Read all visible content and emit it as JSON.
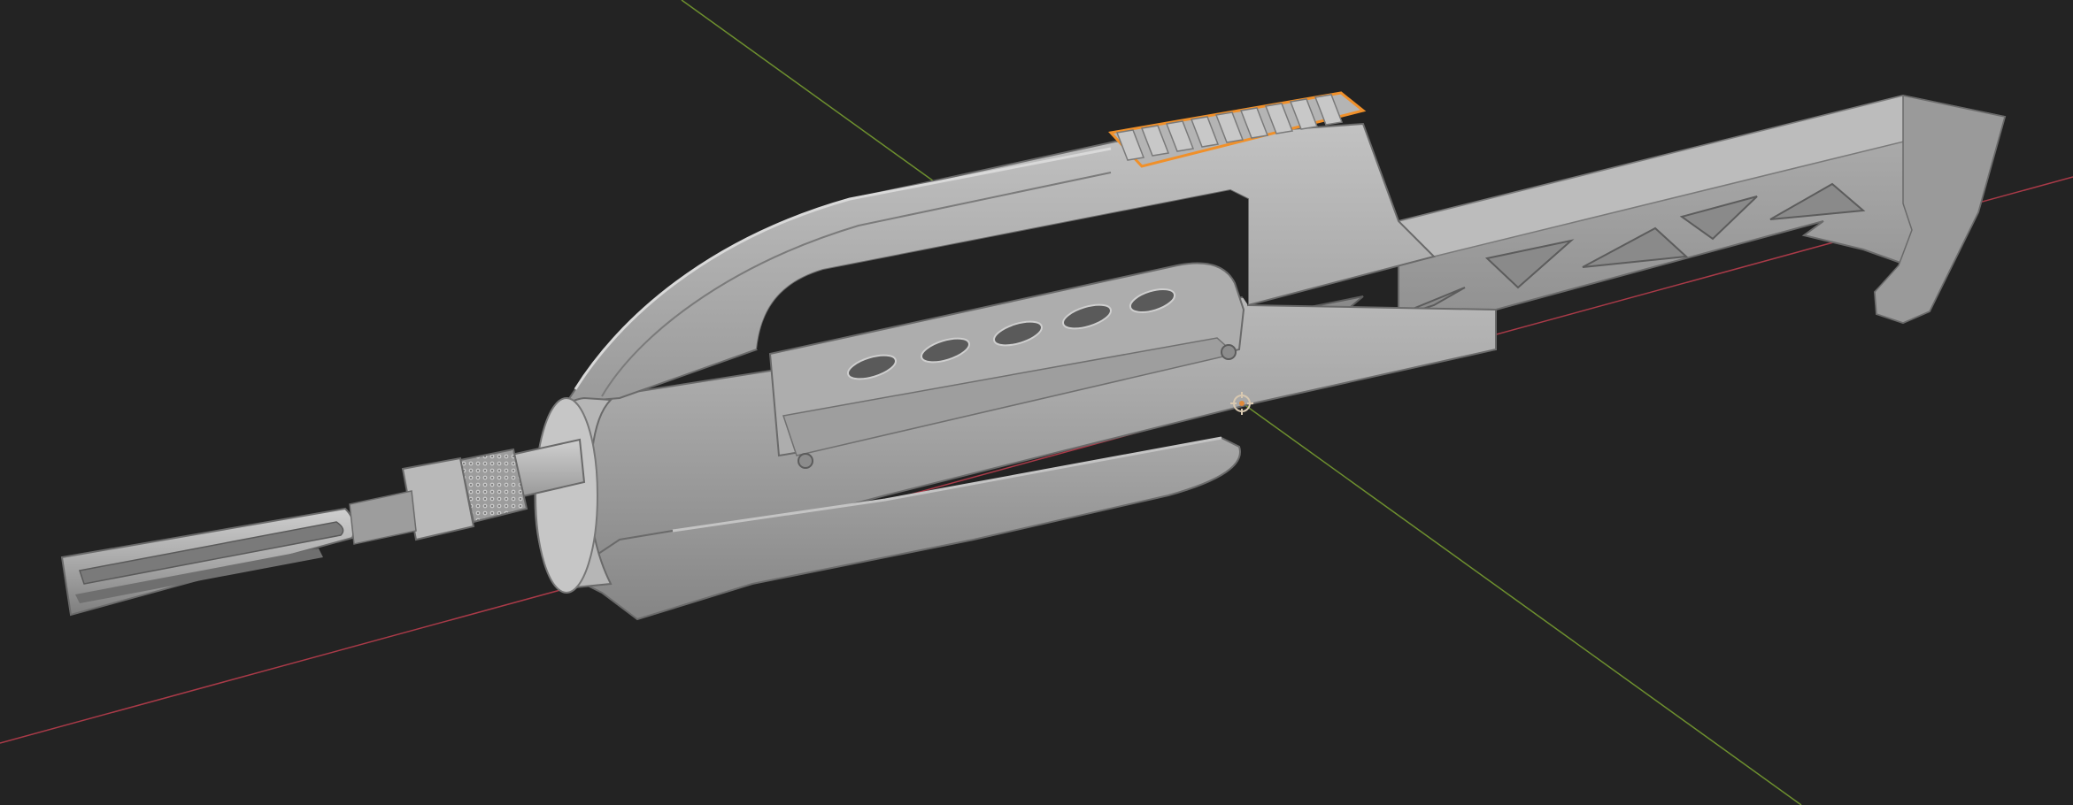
{
  "viewport": {
    "background_color": "#232323",
    "mode": "3d-viewport",
    "shading": "solid"
  },
  "axes": {
    "x_axis_color": "#a93a48",
    "y_axis_color": "#6d8f2e"
  },
  "object": {
    "subject": "rifle-model",
    "base_color": "#a3a3a3",
    "selection_outline_color": "#f0902a",
    "selected_part": "top-rail"
  },
  "origin_marker": {
    "icon": "object-origin-icon",
    "color": "#d8c8b0"
  }
}
